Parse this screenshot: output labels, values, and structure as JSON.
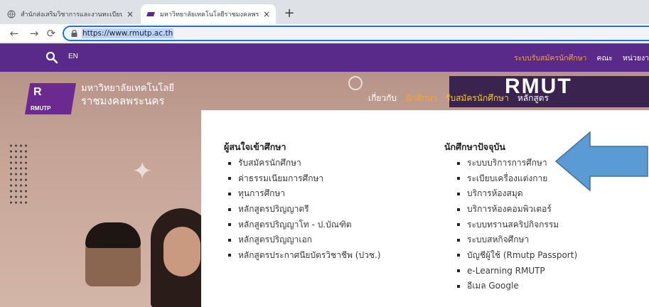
{
  "browser": {
    "tabs": [
      {
        "title": "สำนักส่งเสริมวิชาการและงานทะเบียน",
        "active": false
      },
      {
        "title": "มหาวิทยาลัยเทคโนโลยีราชมงคลพระนคร",
        "active": true
      }
    ],
    "new_tab": "+",
    "close_glyph": "×",
    "url": "https://www.rmutp.ac.th"
  },
  "site_header": {
    "lang": "EN",
    "nav": [
      "ระบบรับสมัครนักศึกษา",
      "คณะ",
      "หน่วยงา"
    ]
  },
  "hero": {
    "logo_letters": "R",
    "logo_tag": "RMUTP",
    "name_line1": "มหาวิทยาลัยเทคโนโลยี",
    "name_line2": "ราชมงคลพระนคร",
    "brand_big": "RMUT",
    "main_nav": [
      "เกี่ยวกับ",
      "นักศึกษา",
      "รับสมัครนักศึกษา",
      "หลักสูตร"
    ]
  },
  "dropdown": {
    "prospective": {
      "heading": "ผู้สนใจเข้าศึกษา",
      "items": [
        "รับสมัครนักศึกษา",
        "ค่าธรรมเนียมการศึกษา",
        "ทุนการศึกษา",
        "หลักสูตรปริญญาตรี",
        "หลักสูตรปริญญาโท - ป.บัณฑิต",
        "หลักสูตรปริญญาเอก",
        "หลักสูตรประกาศนียบัตรวิชาชีพ (ปวช.)"
      ]
    },
    "current": {
      "heading": "นักศึกษาปัจจุบัน",
      "items": [
        "ระบบบริการการศึกษา",
        "ระเบียบเครื่องแต่งกาย",
        "บริการห้องสมุด",
        "บริการห้องคอมพิวเตอร์",
        "ระบบทรานสคริปกิจกรรม",
        "ระบบสหกิจศึกษา",
        "บัญชีผู้ใช้ (Rmutp Passport)",
        "e-Learning RMUTP",
        "อีเมล Google"
      ]
    }
  },
  "colors": {
    "site_purple": "#5a2a8a",
    "nav_orange": "#f5a623",
    "arrow_blue": "#5b9bd5",
    "selection_blue": "#bcd4f8"
  }
}
